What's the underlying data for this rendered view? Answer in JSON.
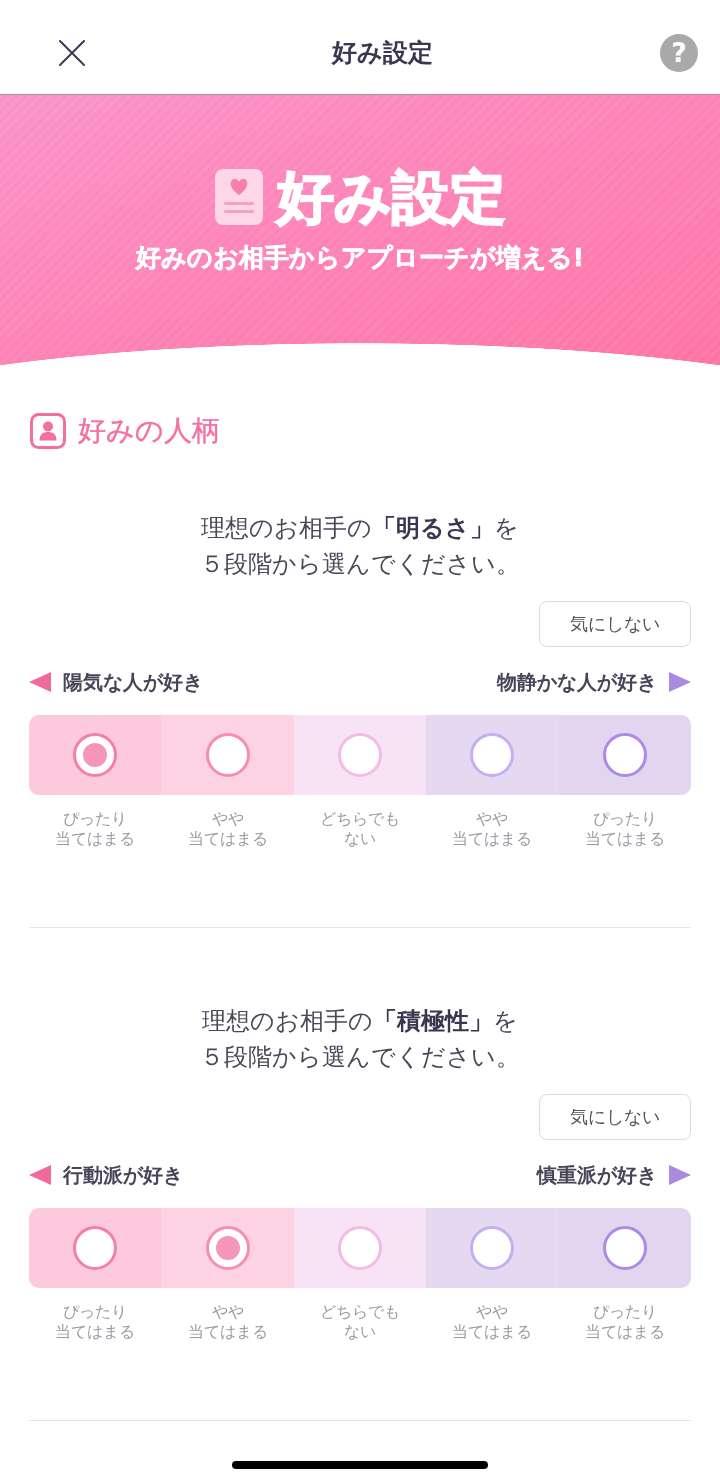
{
  "header": {
    "title": "好み設定",
    "help_button": "?"
  },
  "hero": {
    "title": "好み設定",
    "subtitle": "好みのお相手からアプローチが増える!"
  },
  "section": {
    "title": "好みの人柄"
  },
  "questions": [
    {
      "prompt": "理想のお相手の**「明るさ」**を５段階から選んでください。",
      "skip_button": "気にしない",
      "left_label": "陽気な人が好き",
      "right_label": "物静かな人が好き",
      "options": [
        {
          "label": "ぴったり当てはまる",
          "selected": true
        },
        {
          "label": "やや当てはまる",
          "selected": false
        },
        {
          "label": "どちらでもない",
          "selected": false
        },
        {
          "label": "やや当てはまる",
          "selected": false
        },
        {
          "label": "ぴったり当てはまる",
          "selected": false
        }
      ]
    },
    {
      "prompt": "理想のお相手の**「積極性」**を５段階から選んでください。",
      "skip_button": "気にしない",
      "left_label": "行動派が好き",
      "right_label": "慎重派が好き",
      "options": [
        {
          "label": "ぴったり当てはまる",
          "selected": false
        },
        {
          "label": "やや当てはまる",
          "selected": true
        },
        {
          "label": "どちらでもない",
          "selected": false
        },
        {
          "label": "やや当てはまる",
          "selected": false
        },
        {
          "label": "ぴったり当てはまる",
          "selected": false
        }
      ]
    }
  ]
}
